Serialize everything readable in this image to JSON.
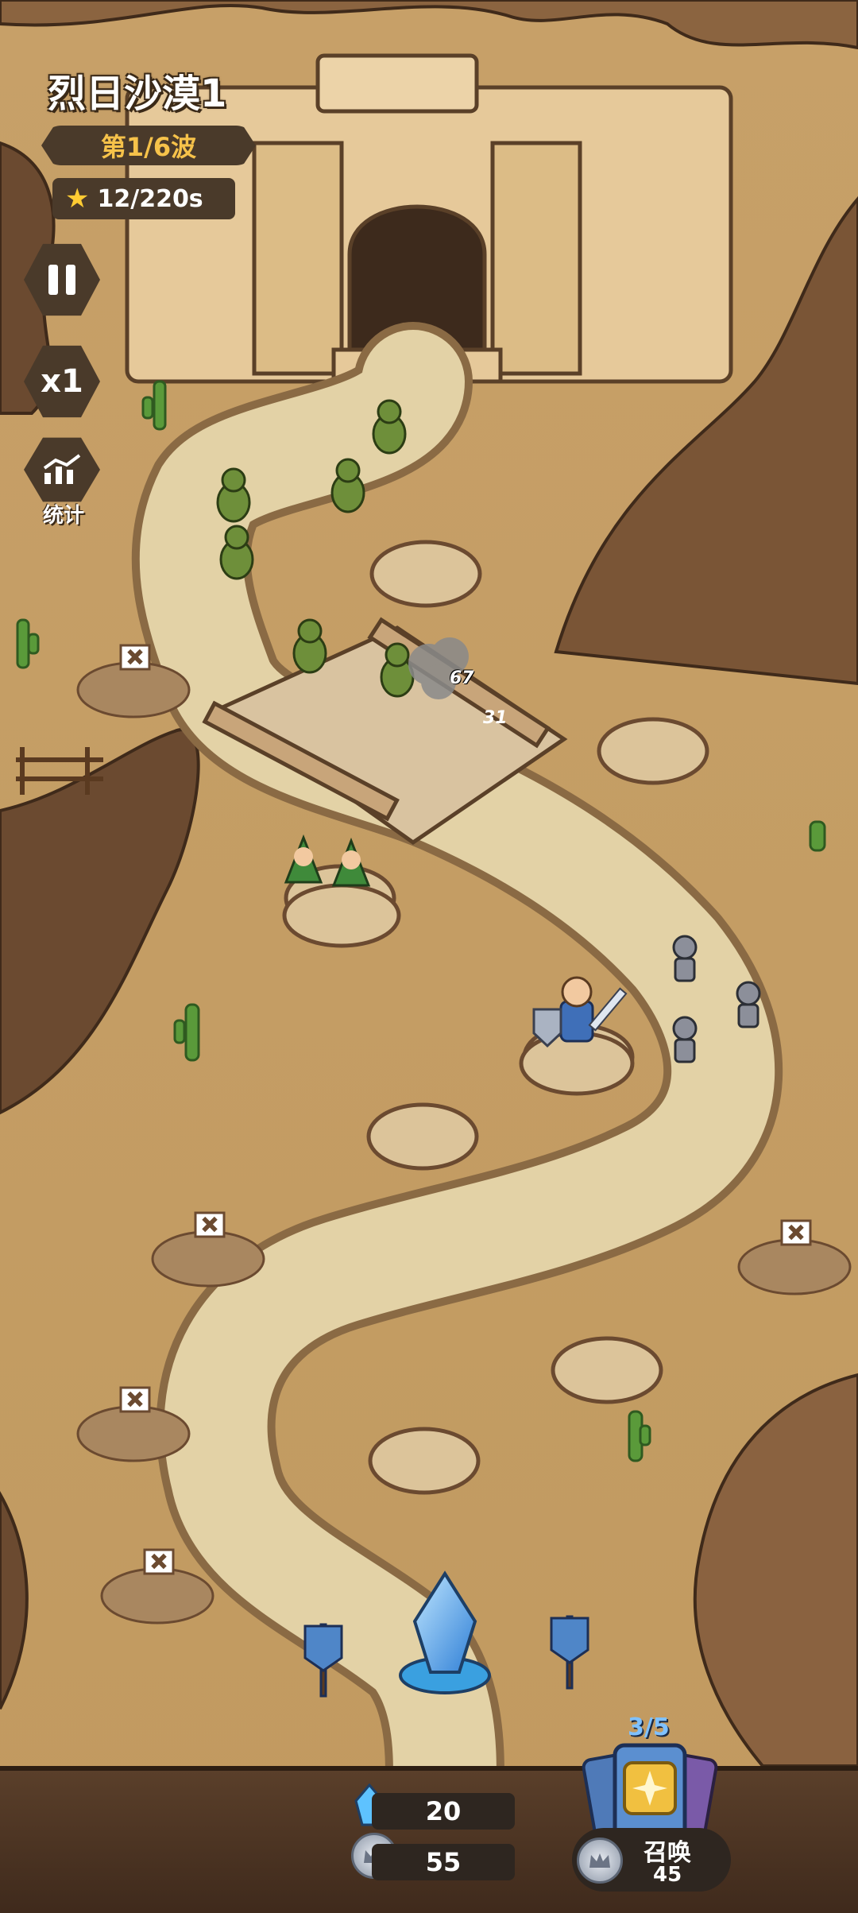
{
  "hud": {
    "level_title": "烈日沙漠1",
    "wave": "第1/6波",
    "timer": "12/220s",
    "speed": "x1",
    "stats_label": "统计"
  },
  "damage_numbers": [
    "67",
    "31"
  ],
  "resources": {
    "crystal": "20",
    "silver": "55"
  },
  "summon": {
    "count": "3/5",
    "label": "召唤",
    "cost": "45"
  },
  "icons": {
    "pause": "pause-icon",
    "stats": "chart-icon",
    "star": "star-icon",
    "crystal": "crystal-icon",
    "silver": "crown-coin-icon"
  },
  "colors": {
    "sand": "#c9a46a",
    "path": "#e3d2a6",
    "canyon": "#6b4a30",
    "hud_panel": "#4a3a2a",
    "wave_text": "#f6c24a",
    "summon_count": "#7fc1ff"
  }
}
